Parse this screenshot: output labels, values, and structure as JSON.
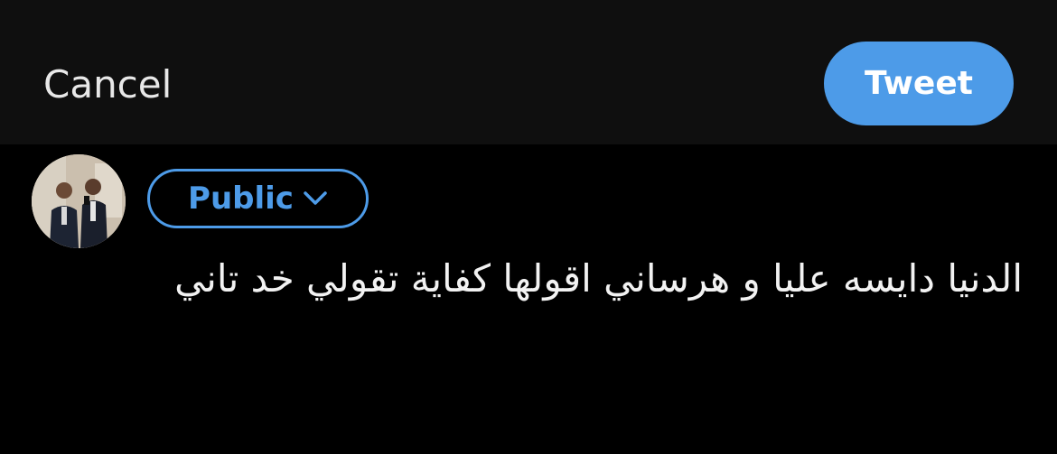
{
  "header": {
    "cancel_label": "Cancel",
    "tweet_label": "Tweet"
  },
  "composer": {
    "audience_label": "Public",
    "text": "الدنيا دايسه عليا و هرساني اقولها كفاية تقولي خد تاني"
  },
  "colors": {
    "accent": "#4d9be8",
    "background": "#000000",
    "header_background": "#0f0f0f"
  },
  "icons": {
    "audience_dropdown": "chevron-down-icon"
  }
}
